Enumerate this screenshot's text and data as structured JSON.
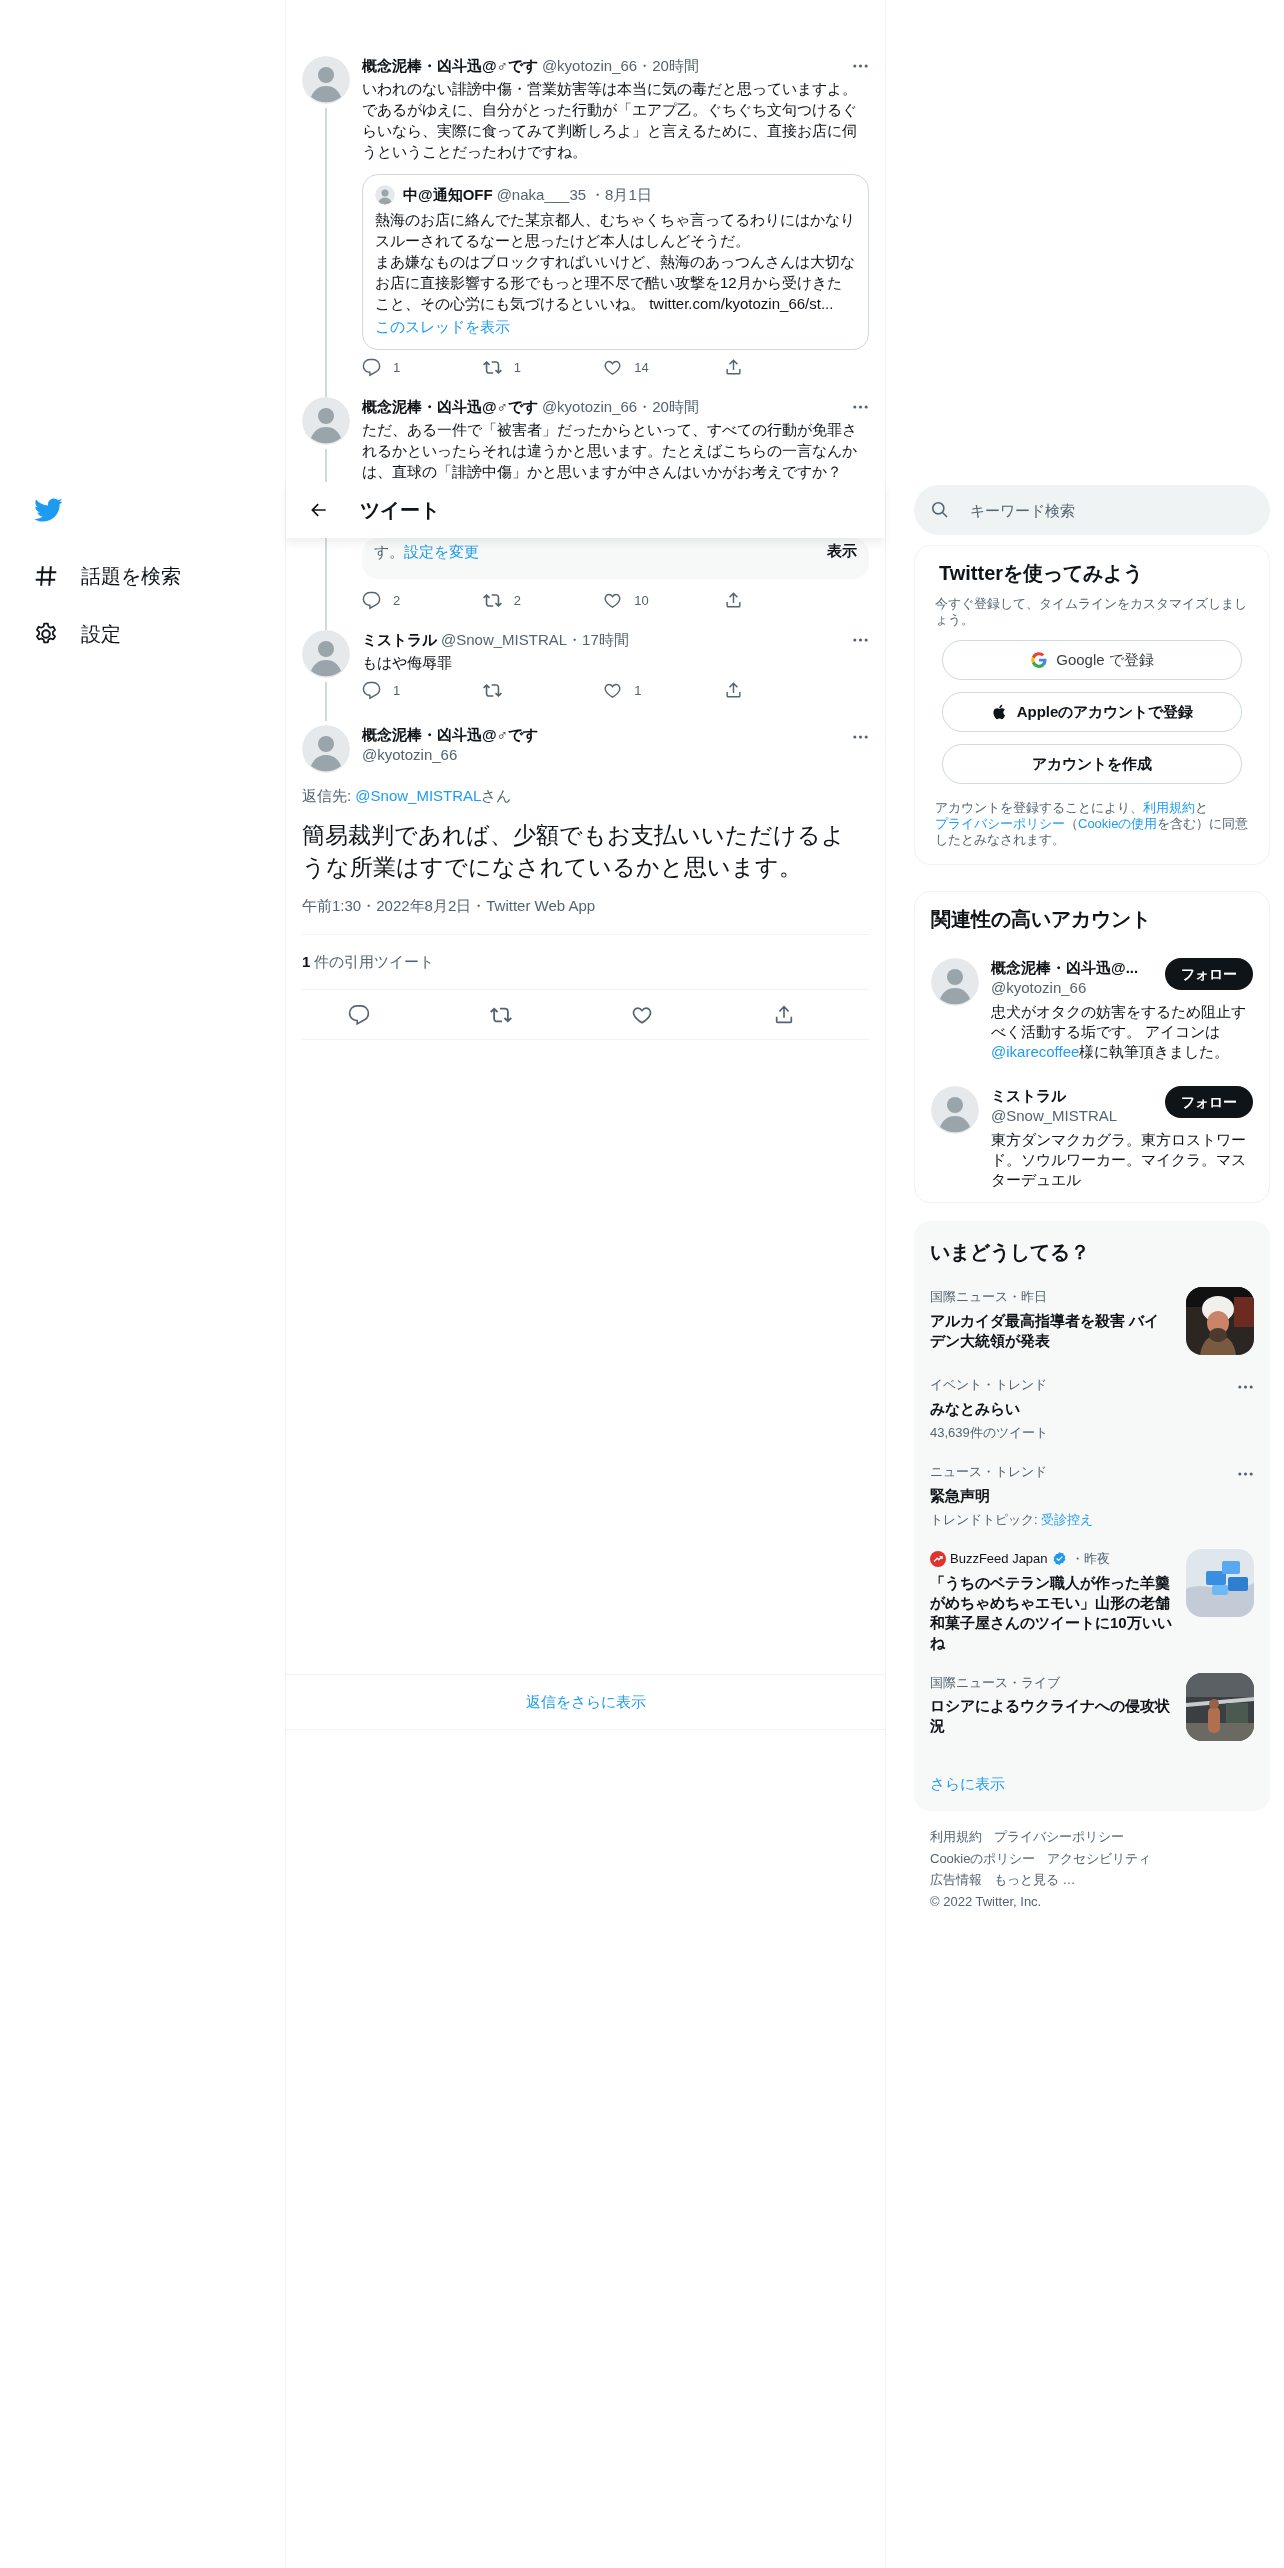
{
  "sidebar": {
    "items": [
      {
        "kind": "explore",
        "label": "話題を検索"
      },
      {
        "kind": "settings",
        "label": "設定"
      }
    ]
  },
  "header": {
    "title": "ツイート"
  },
  "thread": [
    {
      "kind": "reply",
      "name": "概念泥棒・凶斗迅@♂です",
      "handle": "@kyotozin_66",
      "time": "・20時間",
      "text": "いわれのない誹謗中傷・営業妨害等は本当に気の毒だと思っていますよ。であるがゆえに、自分がとった行動が「エアプ乙。ぐちぐち文句つけるぐらいなら、実際に食ってみて判断しろよ」と言えるために、直接お店に伺うということだったわけですね。",
      "quote": {
        "name": "中@通知OFF",
        "handle": "@naka___35",
        "date": "・8月1日",
        "lines": [
          "熱海のお店に絡んでた某京都人、むちゃくちゃ言ってるわりにはかなりスルーされてるなーと思ったけど本人はしんどそうだ。",
          "まあ嫌なものはブロックすればいいけど、熱海のあっつんさんは大切なお店に直接影響する形でもっと理不尽で酷い攻撃を12月から受けきたこと、その心労にも気づけるといいね。"
        ],
        "link": "twitter.com/kyotozin_66/st...",
        "more": "このスレッドを表示"
      },
      "actions": [
        {
          "kind": "reply",
          "count": "1"
        },
        {
          "kind": "retweet",
          "count": "1"
        },
        {
          "kind": "like",
          "count": "14"
        },
        {
          "kind": "share"
        }
      ]
    },
    {
      "kind": "reply",
      "name": "概念泥棒・凶斗迅@♂です",
      "handle": "@kyotozin_66",
      "time": "・20時間",
      "text": "ただ、ある一件で「被害者」だったからといって、すべての行動が免罪されるかといったらそれは違うかと思います。たとえばこちらの一言なんかは、直球の「誹謗中傷」かと思いますが中さんはいかがお考えですか？",
      "notice": {
        "text": "す。",
        "link": "設定を変更",
        "button": "表示"
      },
      "actions": [
        {
          "kind": "reply",
          "count": "2"
        },
        {
          "kind": "retweet",
          "count": "2"
        },
        {
          "kind": "like",
          "count": "10"
        },
        {
          "kind": "share"
        }
      ]
    },
    {
      "kind": "reply",
      "name": "ミストラル",
      "handle": "@Snow_MISTRAL",
      "time": "・17時間",
      "text": "もはや侮辱罪",
      "actions": [
        {
          "kind": "reply",
          "count": "1"
        },
        {
          "kind": "retweet"
        },
        {
          "kind": "like",
          "count": "1"
        },
        {
          "kind": "share"
        }
      ]
    },
    {
      "kind": "focus",
      "name": "概念泥棒・凶斗迅@♂です",
      "handle": "@kyotozin_66",
      "reply_to": {
        "prefix": "返信先: ",
        "handle": "@Snow_MISTRAL",
        "suffix": "さん"
      },
      "text": "簡易裁判であれば、少額でもお支払いいただけるような所業はすでになされているかと思います。",
      "meta": "午前1:30・2022年8月2日・Twitter Web App",
      "quote_count": {
        "count": "1",
        "label": "件の引用ツイート"
      },
      "actions": [
        {
          "kind": "reply"
        },
        {
          "kind": "retweet"
        },
        {
          "kind": "like"
        },
        {
          "kind": "share"
        }
      ]
    }
  ],
  "more_replies": "返信をさらに表示",
  "search": {
    "placeholder": "キーワード検索"
  },
  "signup": {
    "title": "Twitterを使ってみよう",
    "subtitle": "今すぐ登録して、タイムラインをカスタマイズしましょう。",
    "buttons": [
      {
        "kind": "google",
        "label": "Google で登録"
      },
      {
        "kind": "apple",
        "label": "Appleのアカウントで登録"
      },
      {
        "kind": "plain",
        "label": "アカウントを作成"
      }
    ],
    "legal": [
      {
        "text": "アカウントを登録することにより、",
        "link": false
      },
      {
        "text": "利用規約",
        "link": true
      },
      {
        "text": "と",
        "link": false
      },
      {
        "text": "プライバシーポリシー",
        "link": true
      },
      {
        "text": "（",
        "link": false
      },
      {
        "text": "Cookieの使用",
        "link": true
      },
      {
        "text": "を含む）に同意したとみなされます。",
        "link": false
      }
    ]
  },
  "related": {
    "title": "関連性の高いアカウント",
    "accounts": [
      {
        "name": "概念泥棒・凶斗迅@...",
        "handle": "@kyotozin_66",
        "button": "フォロー",
        "bio": [
          {
            "text": "忠犬がオタクの妨害をするため阻止すべく活動する垢です。 アイコンは",
            "link": false
          },
          {
            "text": "@ikarecoffee",
            "link": true
          },
          {
            "text": "様に執筆頂きました。",
            "link": false
          }
        ]
      },
      {
        "name": "ミストラル",
        "handle": "@Snow_MISTRAL",
        "button": "フォロー",
        "bio": [
          {
            "text": "東方ダンマクカグラ。東方ロストワード。ソウルワーカー。マイクラ。マスターデュエル",
            "link": false
          }
        ]
      }
    ]
  },
  "trends": {
    "title": "いまどうしてる？",
    "items": [
      {
        "kind": "story",
        "meta": "国際ニュース・昨日",
        "title": "アルカイダ最高指導者を殺害 バイデン大統領が発表"
      },
      {
        "kind": "trend",
        "meta": "イベント・トレンド",
        "title": "みなとみらい",
        "sub": "43,639件のツイート"
      },
      {
        "kind": "trend",
        "meta": "ニュース・トレンド",
        "title": "緊急声明",
        "sub": "トレンドトピック: ",
        "sub_link": "受診控え"
      },
      {
        "kind": "publisher",
        "source": "BuzzFeed Japan",
        "verified": true,
        "meta": "・昨夜",
        "title": "「うちのベテラン職人が作った羊羹がめちゃめちゃエモい」山形の老舗和菓子屋さんのツイートに10万いいね"
      },
      {
        "kind": "story",
        "meta": "国際ニュース・ライブ",
        "title": "ロシアによるウクライナへの侵攻状況"
      }
    ],
    "more": "さらに表示"
  },
  "footer": [
    "利用規約",
    "プライバシーポリシー",
    "Cookieのポリシー",
    "アクセシビリティ",
    "広告情報",
    "もっと見る …",
    "© 2022 Twitter, Inc."
  ]
}
